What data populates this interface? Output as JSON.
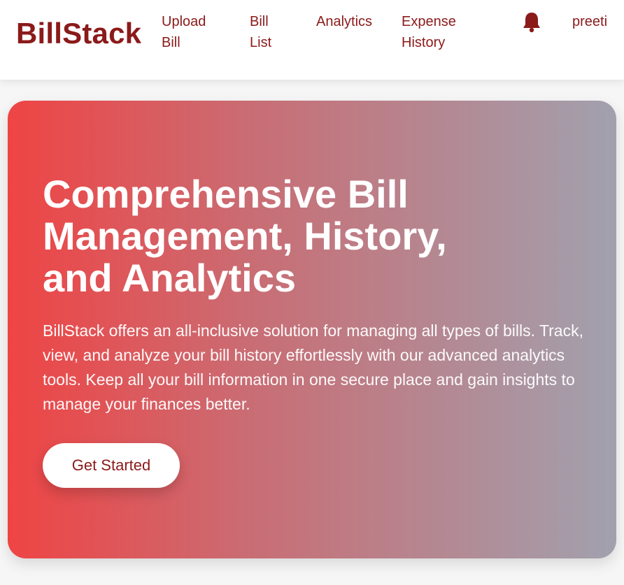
{
  "app": {
    "brand": "BillStack"
  },
  "nav": {
    "upload_bill": "Upload\nBill",
    "bill_list": "Bill\nList",
    "analytics": "Analytics",
    "expense_history": "Expense\nHistory",
    "notification_icon": "bell-icon",
    "user_name": "preeti"
  },
  "hero": {
    "title": "Comprehensive Bill\nManagement, History,\nand Analytics",
    "description": "BillStack offers an all-inclusive solution for managing all types of bills. Track, view, and analyze your bill history effortlessly with our advanced analytics tools. Keep all your bill information in one secure place and gain insights to manage your finances better.",
    "cta_label": "Get Started"
  },
  "colors": {
    "brand": "#8b1a1a",
    "hero_gradient_start": "#ef4444",
    "hero_gradient_end": "#a1a1ae",
    "background": "#f6f6f6"
  }
}
